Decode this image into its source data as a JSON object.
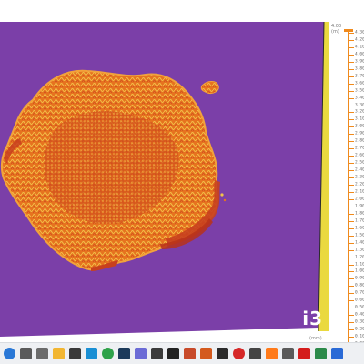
{
  "viewer": {
    "logo": "i3",
    "colors": {
      "background": "#7b3fa8",
      "island_base": "#e6731f",
      "island_dark": "#c8401e",
      "island_light": "#f2c24a",
      "frame_edge": "#e8d52a"
    }
  },
  "ruler": {
    "unit_label": "4.00\n(m)",
    "bottom_unit": "(mm)",
    "ticks": [
      "4.30",
      "4.20",
      "4.10",
      "4.00",
      "3.90",
      "3.80",
      "3.70",
      "3.60",
      "3.50",
      "3.40",
      "3.30",
      "3.20",
      "3.10",
      "3.00",
      "2.90",
      "2.80",
      "2.70",
      "2.60",
      "2.50",
      "2.40",
      "2.30",
      "2.20",
      "2.10",
      "2.00",
      "1.90",
      "1.80",
      "1.70",
      "1.60",
      "1.50",
      "1.40",
      "1.30",
      "1.20",
      "1.10",
      "1.00",
      "0.90",
      "0.80",
      "0.70",
      "0.60",
      "0.50",
      "0.40",
      "0.30",
      "0.20",
      "0.10",
      "0.00"
    ]
  },
  "taskbar": {
    "icons": [
      {
        "name": "windows-start-icon",
        "color": "#2a78d6"
      },
      {
        "name": "search-icon",
        "color": "#5a5a5a"
      },
      {
        "name": "task-view-icon",
        "color": "#6b6b6b"
      },
      {
        "name": "file-explorer-icon",
        "color": "#f2b632"
      },
      {
        "name": "app-icon-1",
        "color": "#3a3a3a"
      },
      {
        "name": "edge-icon",
        "color": "#1a8fd4"
      },
      {
        "name": "chrome-icon",
        "color": "#2fa24a"
      },
      {
        "name": "steam-icon",
        "color": "#1c3a5a"
      },
      {
        "name": "app-icon-2",
        "color": "#6b6bd6"
      },
      {
        "name": "app-icon-3",
        "color": "#3b3b3b"
      },
      {
        "name": "app-icon-4",
        "color": "#222222"
      },
      {
        "name": "app-icon-5",
        "color": "#c84a2a"
      },
      {
        "name": "app-icon-6",
        "color": "#d45a1e"
      },
      {
        "name": "app-icon-7",
        "color": "#2b2b2b"
      },
      {
        "name": "opera-icon",
        "color": "#d62828"
      },
      {
        "name": "app-icon-8",
        "color": "#444444"
      },
      {
        "name": "illustrator-icon",
        "color": "#ff7a1a"
      },
      {
        "name": "app-icon-9",
        "color": "#5a5a5a"
      },
      {
        "name": "acrobat-icon",
        "color": "#d41c1c"
      },
      {
        "name": "app-icon-10",
        "color": "#2c8a4a"
      },
      {
        "name": "app-icon-11",
        "color": "#2a6ad6"
      }
    ]
  }
}
